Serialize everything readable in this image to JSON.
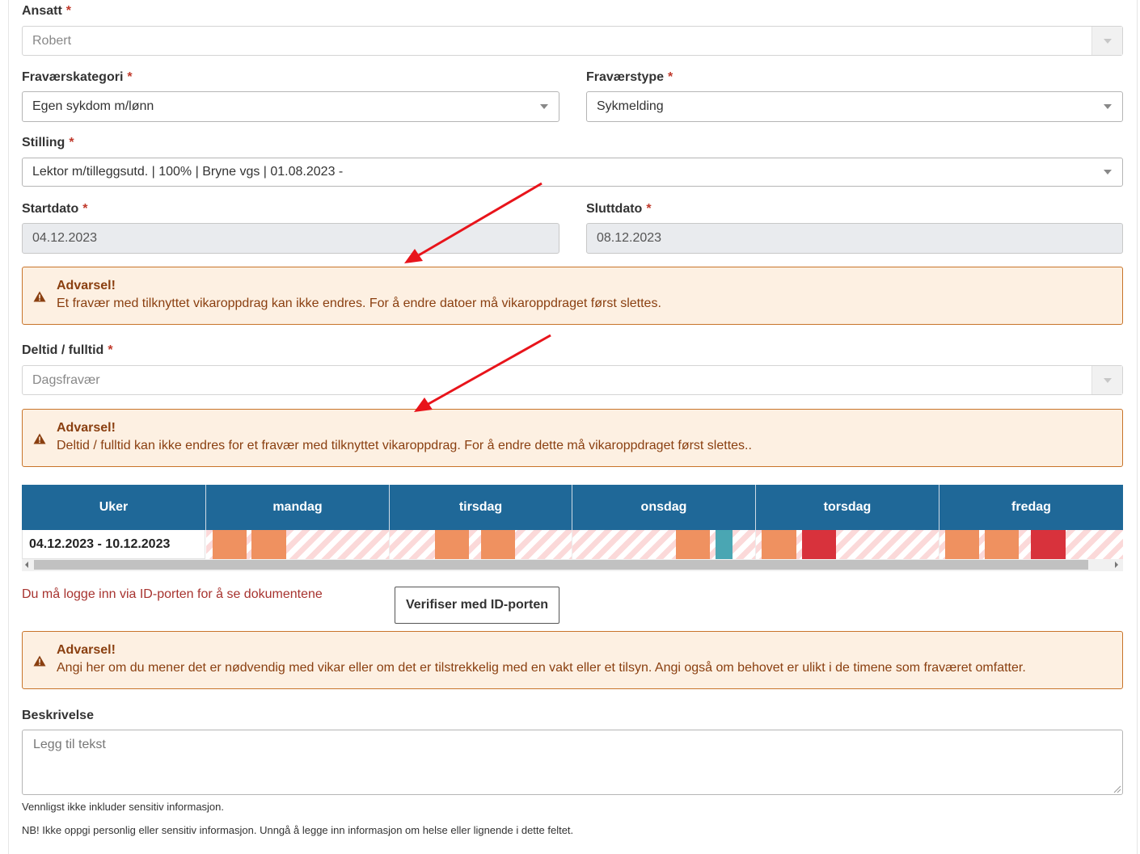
{
  "form": {
    "ansatt": {
      "label": "Ansatt",
      "required_mark": "*",
      "value": "Robert"
    },
    "fravaerskategori": {
      "label": "Fraværskategori",
      "required_mark": "*",
      "value": "Egen sykdom m/lønn"
    },
    "fravaerstype": {
      "label": "Fraværstype",
      "required_mark": "*",
      "value": "Sykmelding"
    },
    "stilling": {
      "label": "Stilling",
      "required_mark": "*",
      "value": "Lektor m/tilleggsutd. | 100% | Bryne vgs | 01.08.2023 -"
    },
    "startdato": {
      "label": "Startdato",
      "required_mark": "*",
      "value": "04.12.2023"
    },
    "sluttdato": {
      "label": "Sluttdato",
      "required_mark": "*",
      "value": "08.12.2023"
    },
    "deltid": {
      "label": "Deltid / fulltid",
      "required_mark": "*",
      "value": "Dagsfravær"
    },
    "beskrivelse": {
      "label": "Beskrivelse",
      "placeholder": "Legg til tekst"
    }
  },
  "alerts": [
    {
      "title": "Advarsel!",
      "text": "Et fravær med tilknyttet vikaroppdrag kan ikke endres. For å endre datoer må vikaroppdraget først slettes."
    },
    {
      "title": "Advarsel!",
      "text": "Deltid / fulltid kan ikke endres for et fravær med tilknyttet vikaroppdrag. For å endre dette må vikaroppdraget først slettes.."
    },
    {
      "title": "Advarsel!",
      "text": "Angi her om du mener det er nødvendig med vikar eller om det er tilstrekkelig med en vakt eller et tilsyn. Angi også om behovet er ulikt i de timene som fraværet omfatter."
    }
  ],
  "week_grid": {
    "headers": [
      "Uker",
      "mandag",
      "tirsdag",
      "onsdag",
      "torsdag",
      "fredag"
    ],
    "row_label": "04.12.2023 - 10.12.2023",
    "colors": {
      "orange": "#ef9160",
      "teal": "#4aa6b3",
      "red": "#d8323c",
      "header_bg": "#1f6898"
    }
  },
  "id_porten": {
    "message": "Du må logge inn via ID-porten for å se dokumentene",
    "button_label": "Verifiser med ID-porten"
  },
  "notes": {
    "note1": "Vennligst ikke inkluder sensitiv informasjon.",
    "note2": "NB! Ikke oppgi personlig eller sensitiv informasjon. Unngå å legge inn informasjon om helse eller lignende i dette feltet."
  }
}
